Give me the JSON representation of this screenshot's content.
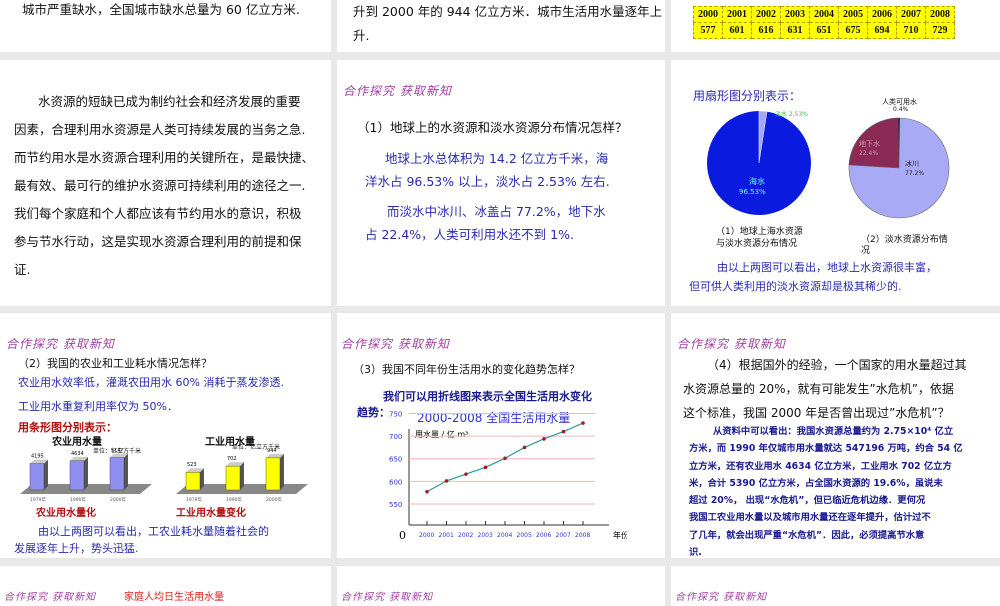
{
  "slides": {
    "s0": {
      "text": "城市严重缺水，全国城市缺水总量为 60 亿立方米."
    },
    "s1": {
      "line1": "升到 2000 年的 944 亿立方米．城市生活用水量逐年上",
      "line2": "升."
    },
    "s2": {
      "years": [
        "2000",
        "2001",
        "2002",
        "2003",
        "2004",
        "2005",
        "2006",
        "2007",
        "2008"
      ],
      "values": [
        "577",
        "601",
        "616",
        "631",
        "651",
        "675",
        "694",
        "710",
        "729"
      ]
    },
    "s3": {
      "lines": [
        "水资源的短缺已成为制约社会和经济发展的重要",
        "因素，合理利用水资源是人类可持续发展的当务之急.",
        "而节约用水是水资源合理利用的关键所在，是最快捷、",
        "最有效、最可行的维护水资源可持续利用的途径之一.",
        "我们每个家庭和个人都应该有节约用水的意识，积极",
        "参与节水行动，这是实现水资源合理利用的前提和保",
        "证."
      ]
    },
    "s4": {
      "heading": "合作探究 获取新知",
      "question": "（1）地球上的水资源和淡水资源分布情况怎样？",
      "p1a": "地球上水总体积为 14.2 亿立方千米，海",
      "p1b": "洋水占 96.53% 以上，淡水占 2.53% 左右.",
      "p2a": "而淡水中冰川、冰盖占 77.2%，地下水",
      "p2b": "占 22.4%，人类可利用水还不到 1%."
    },
    "s5": {
      "title": "用扇形图分别表示：",
      "pie1": {
        "sea_label": "海水",
        "sea_value": "96.53%",
        "fresh_label": "淡水 2.53%",
        "caption1": "（1）地球上海水资源",
        "caption2": "与淡水资源分布情况"
      },
      "pie2": {
        "human_label": "人类可用水",
        "human_value": "0.4%",
        "ground_label": "地下水",
        "ground_value": "22.4%",
        "ice_label": "冰川",
        "ice_value": "77.2%",
        "caption1": "（2）淡水资源分布情",
        "caption2": "况"
      },
      "conclusion1": "由以上两图可以看出，地球上水资源很丰富，",
      "conclusion2": "但可供人类利用的淡水资源却是极其稀少的."
    },
    "s6": {
      "heading": "合作探究 获取新知",
      "question": "（2）我国的农业和工业耗水情况怎样？",
      "l1": "农业用水效率低，灌溉农田用水 60% 消耗于蒸发渗透.",
      "l2": "工业用水重复利用率仅为 50%．",
      "sub": "用条形图分别表示：",
      "agri": {
        "title": "农业用水量",
        "unit": "单位：亿立方千米",
        "caption": "农业用水量化",
        "years": [
          "1979年",
          "1990年",
          "2000年"
        ],
        "values": [
          "4195",
          "4634",
          "5147"
        ]
      },
      "ind": {
        "title": "工业用水量",
        "unit": "单位：亿立方千米",
        "caption": "工业用水量变化",
        "years": [
          "1979年",
          "1990年",
          "2000年"
        ],
        "values": [
          "523",
          "702",
          "944"
        ]
      },
      "c1": "由以上两图可以看出，工农业耗水量随着社会的",
      "c2": "发展逐年上升，势头迅猛."
    },
    "s7": {
      "heading": "合作探究 获取新知",
      "question": "（3）我国不同年份生活用水的变化趋势怎样？",
      "intro1": "我们可以用折线图来表示全国生活用水变化",
      "intro2": "趋势："
    },
    "s8": {
      "heading": "合作探究 获取新知",
      "q1": "（4）根据国外的经验，一个国家的用水量超过其",
      "q2": "水资源总量的 20%，就有可能发生”水危机”，依据",
      "q3": "这个标准，我国 2000 年是否曾出现过”水危机”？",
      "a": [
        "从资料中可以看出：我国水资源总量约为 2.75×10⁴ 亿立",
        "方米，而 1990 年仅城市用水量就达 547196 万吨，约合 54 亿",
        "立方米，还有农业用水 4634 亿立方米，工业用水 702 亿立方",
        "米，合计 5390 亿立方米，占全国水资源的 19.6%，虽说未",
        "超过 20%，  出现“水危机”，但已临近危机边缘．更何况",
        "我国工农业用水量以及城市用水量还在逐年提升，估计过不",
        "了几年，就会出现严重“水危机”．因此，必须提高节水意",
        "识."
      ]
    },
    "s9": {
      "heading": "合作探究 获取新知",
      "sub": "家庭人均日生活用水量"
    },
    "s10": {
      "heading": "合作探究 获取新知"
    },
    "s11": {
      "heading": "合作探究 获取新知"
    }
  },
  "chart_data": {
    "type": "line",
    "title": "2000-2008 全国生活用水量",
    "ylabel": "用水量 / 亿 m³",
    "xlabel": "年份",
    "origin": "0",
    "x": [
      "2000",
      "2001",
      "2002",
      "2003",
      "2004",
      "2005",
      "2006",
      "2007",
      "2008"
    ],
    "values": [
      577,
      601,
      616,
      631,
      651,
      675,
      694,
      710,
      729
    ],
    "yticks": [
      550,
      600,
      650,
      700,
      750
    ],
    "ylim": [
      500,
      760
    ]
  },
  "colors": {
    "sea": "#0a1adf",
    "fresh": "#a6a8f0",
    "ground": "#8b2a55",
    "ice": "#a9aaf5",
    "bar_agri": "#8f8ff0",
    "bar_ind": "#ffff00"
  }
}
